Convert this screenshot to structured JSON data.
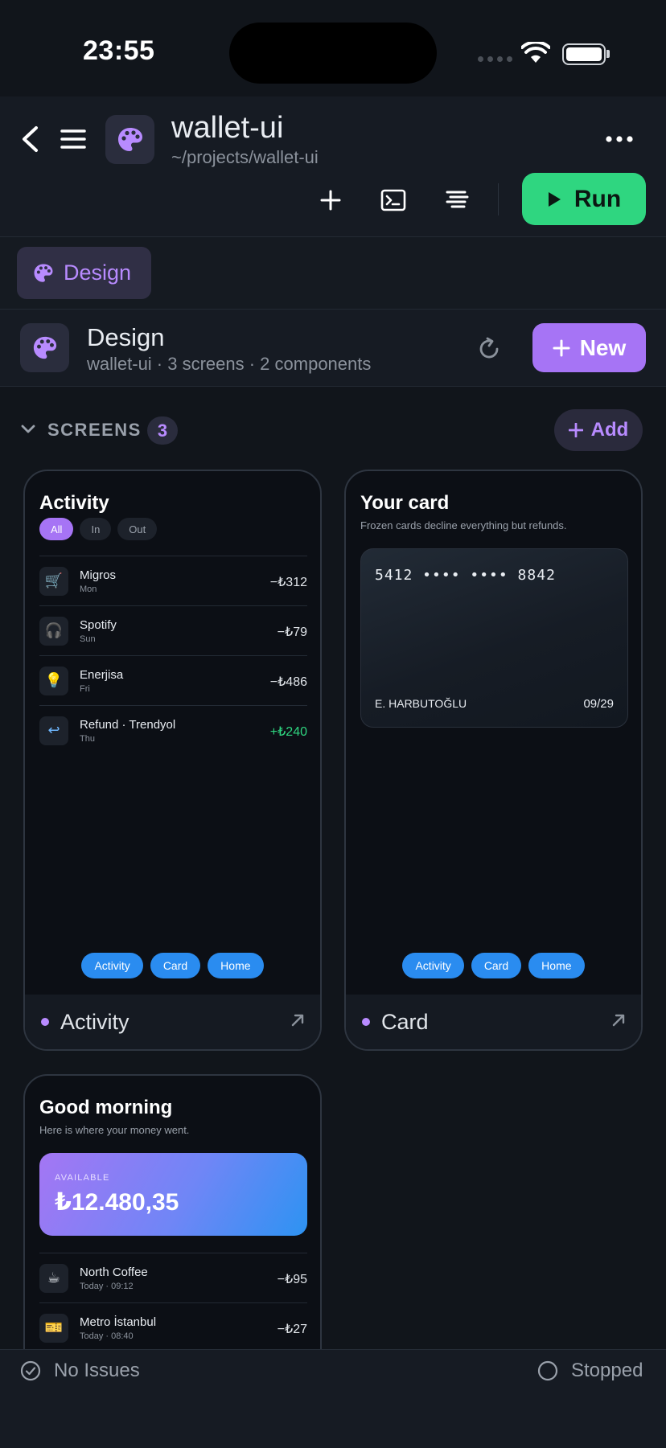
{
  "status_bar": {
    "time": "23:55"
  },
  "header": {
    "title": "wallet-ui",
    "path": "~/projects/wallet-ui",
    "run_label": "Run"
  },
  "tabs": [
    {
      "label": "Design"
    }
  ],
  "panel": {
    "title": "Design",
    "subtitle": "wallet-ui · 3 screens · 2 components",
    "new_label": "New"
  },
  "section": {
    "title": "SCREENS",
    "count": "3",
    "add_label": "Add"
  },
  "screens": {
    "activity": {
      "title": "Activity",
      "filters": [
        "All",
        "In",
        "Out"
      ],
      "rows": [
        {
          "icon": "🛒",
          "name": "Migros",
          "meta": "Mon",
          "amount": "−₺312"
        },
        {
          "icon": "🎧",
          "name": "Spotify",
          "meta": "Sun",
          "amount": "−₺79"
        },
        {
          "icon": "💡",
          "name": "Enerjisa",
          "meta": "Fri",
          "amount": "−₺486"
        },
        {
          "icon": "↩",
          "name": "Refund · Trendyol",
          "meta": "Thu",
          "amount": "+₺240"
        }
      ],
      "nav": [
        "Activity",
        "Card",
        "Home"
      ],
      "footer": "Activity"
    },
    "card": {
      "title": "Your card",
      "subtitle": "Frozen cards decline everything but refunds.",
      "number": "5412 •••• •••• 8842",
      "holder": "E. HARBUTOĞLU",
      "expiry": "09/29",
      "nav": [
        "Activity",
        "Card",
        "Home"
      ],
      "footer": "Card"
    },
    "home": {
      "title": "Good morning",
      "subtitle": "Here is where your money went.",
      "available_label": "AVAILABLE",
      "balance": "₺12.480,35",
      "rows": [
        {
          "icon": "☕",
          "name": "North Coffee",
          "meta": "Today · 09:12",
          "amount": "−₺95"
        },
        {
          "icon": "🎫",
          "name": "Metro İstanbul",
          "meta": "Today · 08:40",
          "amount": "−₺27"
        }
      ]
    }
  },
  "bottom": {
    "issues": "No Issues",
    "run_state": "Stopped"
  },
  "colors": {
    "accent": "#a674f5",
    "run": "#2fd680",
    "nav_chip": "#2a8cf0",
    "background": "#11151b"
  }
}
